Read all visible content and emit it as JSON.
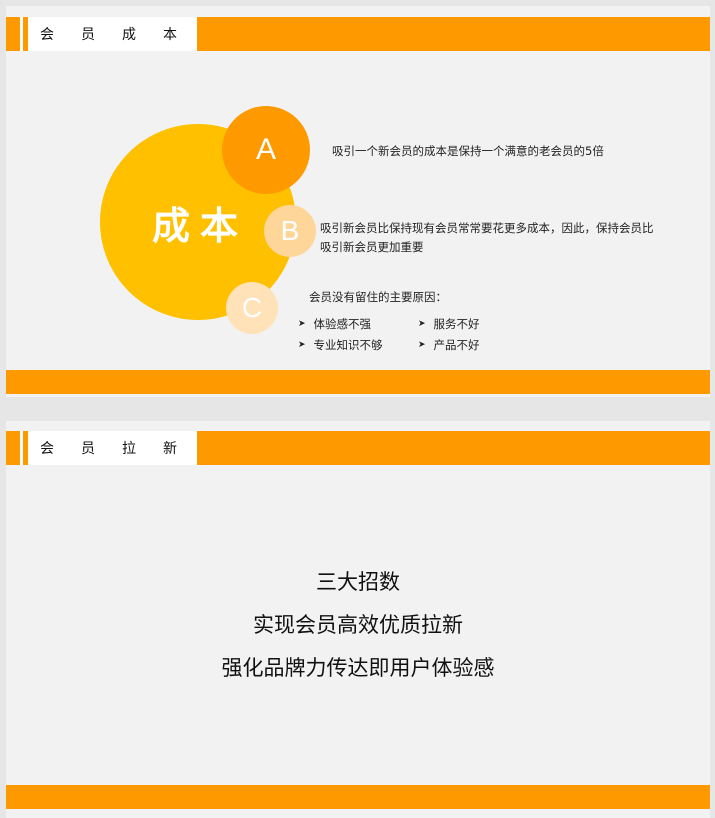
{
  "slide1": {
    "header_title": "会员成本",
    "big_circle_label": "成本",
    "circle_a": "A",
    "circle_b": "B",
    "circle_c": "C",
    "text_a": "吸引一个新会员的成本是保持一个满意的老会员的5倍",
    "text_b": "吸引新会员比保持现有会员常常要花更多成本，因此，保持会员比吸引新会员更加重要",
    "text_c_title": "会员没有留住的主要原因：",
    "reasons": [
      "体验感不强",
      "服务不好",
      "专业知识不够",
      "产品不好"
    ],
    "colors": {
      "accent": "#ff9900",
      "big_circle": "#ffc000",
      "circle_b": "#ffd699",
      "circle_c": "#ffe2b8"
    }
  },
  "slide2": {
    "header_title": "会员拉新",
    "lines": [
      "三大招数",
      "实现会员高效优质拉新",
      "强化品牌力传达即用户体验感"
    ]
  }
}
